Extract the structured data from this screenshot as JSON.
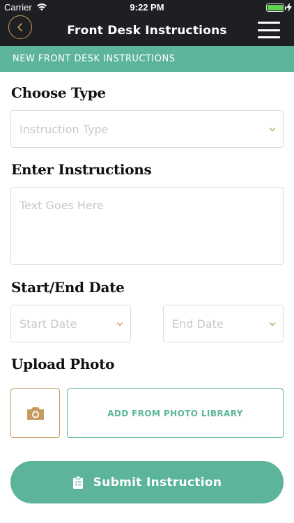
{
  "status_bar": {
    "carrier": "Carrier",
    "time": "9:22 PM"
  },
  "nav": {
    "title": "Front Desk Instructions",
    "back_icon": "chevron-left-icon",
    "menu_icon": "hamburger-menu-icon"
  },
  "banner": {
    "text": "NEW FRONT DESK INSTRUCTIONS"
  },
  "form": {
    "type_label": "Choose Type",
    "type_placeholder": "Instruction Type",
    "instructions_label": "Enter Instructions",
    "instructions_placeholder": "Text Goes Here",
    "date_label": "Start/End Date",
    "start_placeholder": "Start Date",
    "end_placeholder": "End Date",
    "photo_label": "Upload Photo",
    "library_button": "ADD FROM PHOTO LIBRARY",
    "submit_button": "Submit Instruction"
  },
  "colors": {
    "accent": "#5cb59a",
    "gold": "#c59b5f",
    "dark": "#1d1f22"
  }
}
